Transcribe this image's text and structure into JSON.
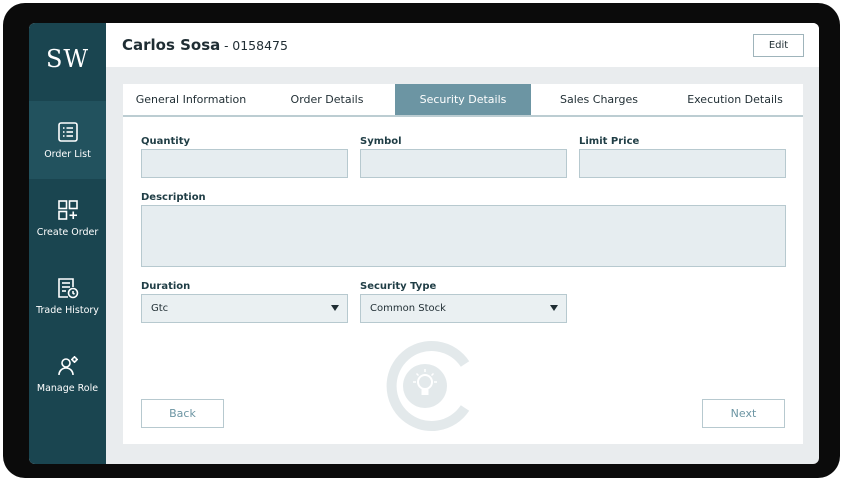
{
  "app": {
    "logo_text": "SW"
  },
  "sidebar": {
    "items": [
      {
        "label": "Order List",
        "icon": "list-icon"
      },
      {
        "label": "Create Order",
        "icon": "create-order-icon"
      },
      {
        "label": "Trade History",
        "icon": "trade-history-icon"
      },
      {
        "label": "Manage Role",
        "icon": "manage-role-icon"
      }
    ]
  },
  "header": {
    "client_name": "Carlos Sosa",
    "separator": " - ",
    "account_number": "0158475",
    "edit_label": "Edit"
  },
  "tabs": [
    {
      "label": "General Information"
    },
    {
      "label": "Order Details"
    },
    {
      "label": "Security Details",
      "active": true
    },
    {
      "label": "Sales Charges"
    },
    {
      "label": "Execution Details"
    }
  ],
  "form": {
    "quantity_label": "Quantity",
    "quantity_value": "",
    "symbol_label": "Symbol",
    "symbol_value": "",
    "limit_price_label": "Limit Price",
    "limit_price_value": "",
    "description_label": "Description",
    "description_value": "",
    "duration_label": "Duration",
    "duration_value": "Gtc",
    "security_type_label": "Security Type",
    "security_type_value": "Common Stock"
  },
  "footer": {
    "back_label": "Back",
    "next_label": "Next"
  },
  "colors": {
    "sidebar": "#1a4550",
    "sidebar_active": "#22525e",
    "tab_active": "#6c95a3",
    "input_bg": "#e6edf0",
    "canvas": "#e9ecee"
  }
}
